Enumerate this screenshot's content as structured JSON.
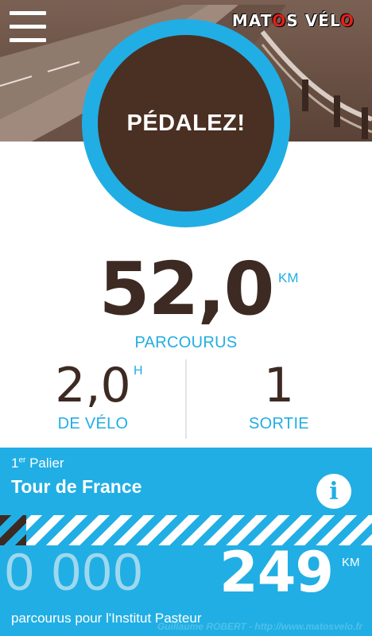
{
  "header": {
    "menu_icon": "hamburger-menu-icon",
    "logo_text_left": "MAT",
    "logo_text_o": "O",
    "logo_text_mid": "S V",
    "logo_text_e": "É",
    "logo_text_right": "L",
    "logo_text_o2": "O"
  },
  "hero": {
    "action_label": "PÉDALEZ!"
  },
  "stats": {
    "distance_value": "52,0",
    "distance_unit": "KM",
    "distance_label": "PARCOURUS",
    "hours_value": "2,0",
    "hours_unit": "H",
    "hours_label": "DE VÉLO",
    "rides_value": "1",
    "rides_label": "SORTIE"
  },
  "goal": {
    "level_prefix": "1",
    "level_sup": "er",
    "level_label": " Palier",
    "title": "Tour de France",
    "info_icon": "info-icon",
    "progress_fraction": 0.07,
    "zeros": "0 000",
    "count": "249",
    "count_unit": "KM",
    "caption": "parcourus pour l'Institut Pasteur",
    "credit": "Guillaume ROBERT - http://www.matosvelo.fr"
  },
  "colors": {
    "accent_blue": "#21aee4",
    "brown": "#4a2f23",
    "text_brown": "#3d2a22"
  }
}
